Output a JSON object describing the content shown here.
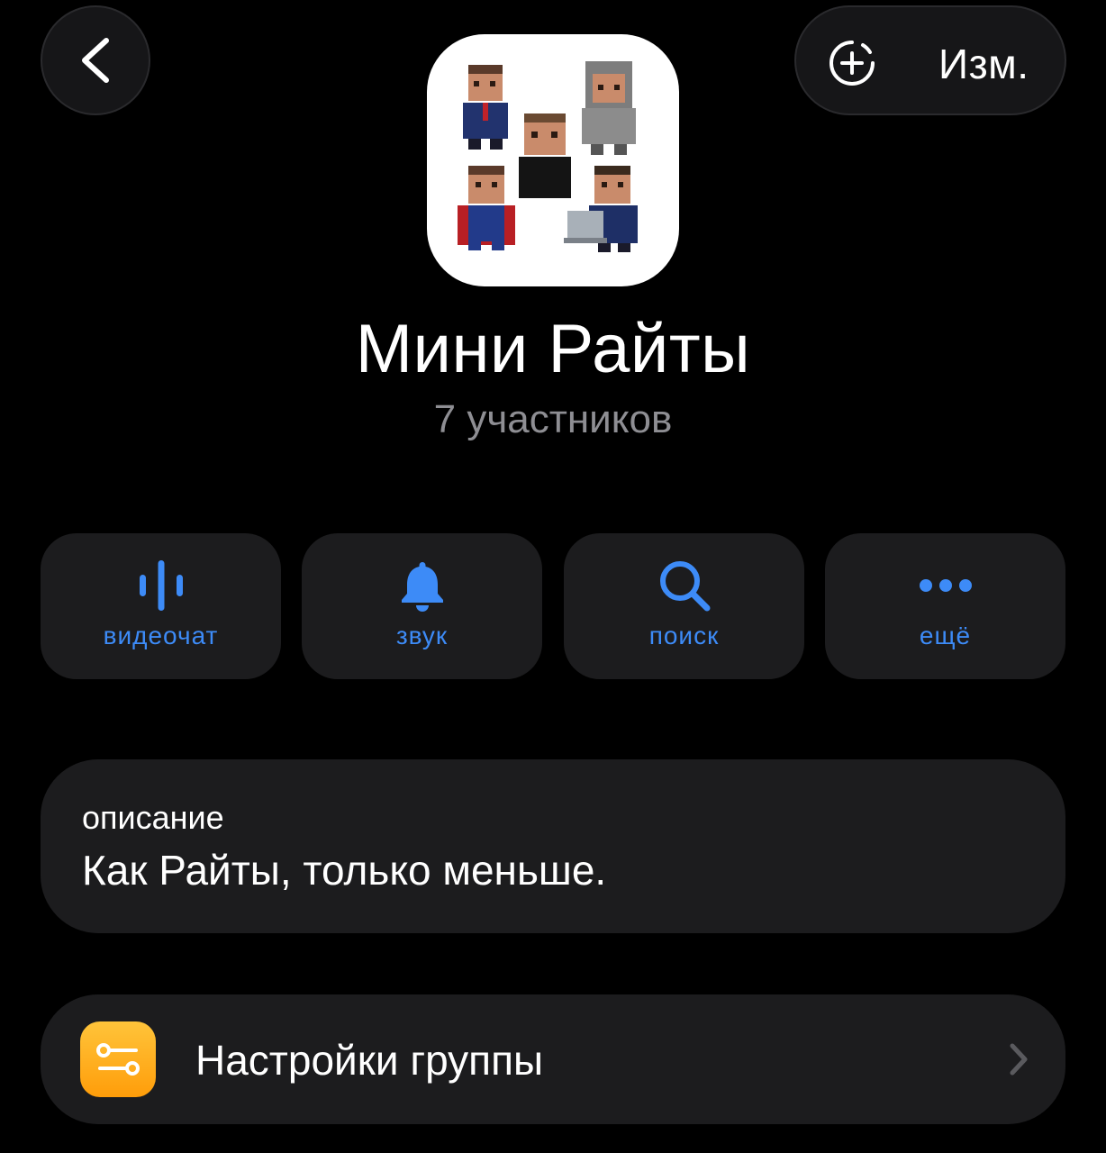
{
  "header": {
    "back_icon": "chevron-left-icon",
    "add_icon": "add-circle-icon",
    "edit_label": "Изм."
  },
  "group": {
    "name": "Мини Райты",
    "members": "7 участников"
  },
  "actions": [
    {
      "label": "видеочат",
      "icon": "waveform-icon"
    },
    {
      "label": "звук",
      "icon": "bell-icon"
    },
    {
      "label": "поиск",
      "icon": "search-icon"
    },
    {
      "label": "ещё",
      "icon": "ellipsis-icon"
    }
  ],
  "description": {
    "label": "описание",
    "text": "Как Райты, только меньше."
  },
  "settings": {
    "label": "Настройки группы",
    "icon": "sliders-icon"
  },
  "colors": {
    "background": "#000000",
    "card": "#1c1c1e",
    "accent": "#3d8bf7",
    "secondary_text": "#8e8e93",
    "settings_icon_bg": "#ff9d0a"
  }
}
